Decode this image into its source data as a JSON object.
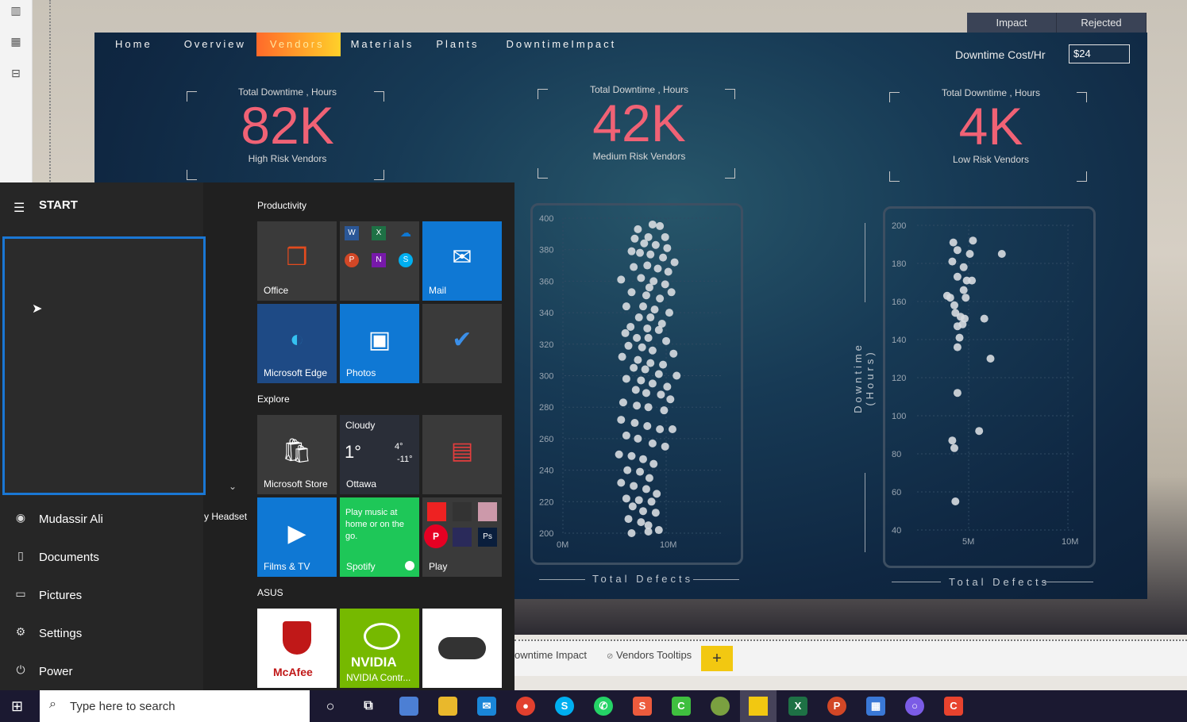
{
  "report": {
    "nav": [
      "Home",
      "Overview",
      "Vendors",
      "Materials",
      "Plants",
      "DowntimeImpact"
    ],
    "active_nav": "Vendors",
    "top_tabs": [
      "Impact",
      "Rejected"
    ],
    "cost_label": "Downtime Cost/Hr",
    "cost_value": "$24",
    "kpis": [
      {
        "caption": "Total Downtime , Hours",
        "value": "82K",
        "sub": "High Risk Vendors"
      },
      {
        "caption": "Total Downtime , Hours",
        "value": "42K",
        "sub": "Medium Risk Vendors"
      },
      {
        "caption": "Total Downtime , Hours",
        "value": "4K",
        "sub": "Low Risk Vendors"
      }
    ],
    "y_axis_title": "Downtime (Hours)",
    "accent": "#f06275"
  },
  "chart_data": [
    {
      "type": "scatter",
      "xlabel": "Total Defects",
      "x_ticks": [
        "0M",
        "10M"
      ],
      "y_ticks": [
        "400",
        "380",
        "360",
        "340",
        "320",
        "300",
        "280",
        "260",
        "240",
        "220",
        "200"
      ],
      "ylim": [
        200,
        400
      ],
      "points": [
        [
          7.0,
          393
        ],
        [
          8.4,
          396
        ],
        [
          9.1,
          395
        ],
        [
          8.0,
          388
        ],
        [
          9.6,
          388
        ],
        [
          6.7,
          387
        ],
        [
          7.6,
          384
        ],
        [
          8.7,
          383
        ],
        [
          9.8,
          381
        ],
        [
          6.4,
          379
        ],
        [
          7.2,
          378
        ],
        [
          8.2,
          377
        ],
        [
          9.4,
          375
        ],
        [
          10.5,
          372
        ],
        [
          7.9,
          370
        ],
        [
          8.9,
          368
        ],
        [
          6.6,
          369
        ],
        [
          9.9,
          366
        ],
        [
          5.4,
          361
        ],
        [
          7.3,
          362
        ],
        [
          8.5,
          360
        ],
        [
          9.6,
          358
        ],
        [
          8.1,
          356
        ],
        [
          10.2,
          353
        ],
        [
          6.4,
          353
        ],
        [
          7.8,
          351
        ],
        [
          9.1,
          349
        ],
        [
          5.9,
          344
        ],
        [
          7.5,
          344
        ],
        [
          8.6,
          342
        ],
        [
          10.0,
          340
        ],
        [
          7.1,
          337
        ],
        [
          8.2,
          337
        ],
        [
          9.3,
          333
        ],
        [
          6.3,
          331
        ],
        [
          7.9,
          330
        ],
        [
          9.0,
          329
        ],
        [
          5.8,
          327
        ],
        [
          6.9,
          324
        ],
        [
          8.0,
          324
        ],
        [
          9.7,
          322
        ],
        [
          6.1,
          319
        ],
        [
          7.4,
          318
        ],
        [
          8.4,
          316
        ],
        [
          10.4,
          314
        ],
        [
          5.5,
          312
        ],
        [
          7.0,
          310
        ],
        [
          8.2,
          308
        ],
        [
          9.4,
          307
        ],
        [
          6.6,
          305
        ],
        [
          7.7,
          304
        ],
        [
          9.0,
          301
        ],
        [
          10.7,
          300
        ],
        [
          5.9,
          298
        ],
        [
          7.3,
          297
        ],
        [
          8.4,
          295
        ],
        [
          9.8,
          293
        ],
        [
          6.8,
          291
        ],
        [
          7.8,
          289
        ],
        [
          9.2,
          288
        ],
        [
          10.1,
          285
        ],
        [
          5.6,
          283
        ],
        [
          6.9,
          281
        ],
        [
          8.0,
          280
        ],
        [
          9.5,
          278
        ],
        [
          5.4,
          272
        ],
        [
          6.7,
          270
        ],
        [
          7.9,
          268
        ],
        [
          9.1,
          266
        ],
        [
          10.3,
          266
        ],
        [
          5.9,
          262
        ],
        [
          7.0,
          260
        ],
        [
          8.4,
          257
        ],
        [
          9.6,
          255
        ],
        [
          5.2,
          250
        ],
        [
          6.4,
          249
        ],
        [
          7.5,
          247
        ],
        [
          8.5,
          244
        ],
        [
          6.0,
          240
        ],
        [
          7.2,
          239
        ],
        [
          8.1,
          235
        ],
        [
          5.4,
          232
        ],
        [
          6.6,
          230
        ],
        [
          7.8,
          228
        ],
        [
          8.8,
          225
        ],
        [
          5.9,
          222
        ],
        [
          7.1,
          221
        ],
        [
          8.3,
          220
        ],
        [
          6.5,
          217
        ],
        [
          7.5,
          214
        ],
        [
          8.7,
          213
        ],
        [
          6.1,
          209
        ],
        [
          7.3,
          207
        ],
        [
          8.0,
          205
        ],
        [
          9.0,
          202
        ],
        [
          6.4,
          200
        ],
        [
          8.0,
          201
        ]
      ]
    },
    {
      "type": "scatter",
      "xlabel": "Total Defects",
      "x_ticks": [
        "5M",
        "10M"
      ],
      "y_ticks": [
        "200",
        "180",
        "160",
        "140",
        "120",
        "100",
        "80",
        "60",
        "40"
      ],
      "ylim": [
        40,
        200
      ],
      "points": [
        [
          4.9,
          191
        ],
        [
          6.8,
          192
        ],
        [
          5.3,
          187
        ],
        [
          6.5,
          185
        ],
        [
          9.6,
          185
        ],
        [
          4.8,
          181
        ],
        [
          5.9,
          178
        ],
        [
          5.3,
          173
        ],
        [
          6.2,
          171
        ],
        [
          6.7,
          171
        ],
        [
          5.9,
          166
        ],
        [
          6.1,
          162
        ],
        [
          4.3,
          163
        ],
        [
          4.6,
          162
        ],
        [
          5.0,
          158
        ],
        [
          5.1,
          154
        ],
        [
          5.6,
          152
        ],
        [
          6.0,
          151
        ],
        [
          5.8,
          148
        ],
        [
          7.9,
          151
        ],
        [
          5.3,
          147
        ],
        [
          5.5,
          141
        ],
        [
          5.3,
          136
        ],
        [
          8.5,
          130
        ],
        [
          5.3,
          112
        ],
        [
          7.4,
          92
        ],
        [
          4.8,
          87
        ],
        [
          5.0,
          83
        ],
        [
          5.1,
          55
        ]
      ]
    }
  ],
  "start_menu": {
    "title": "START",
    "side": [
      {
        "icon": "user-icon",
        "label": "Mudassir Ali"
      },
      {
        "icon": "document-icon",
        "label": "Documents"
      },
      {
        "icon": "pictures-icon",
        "label": "Pictures"
      },
      {
        "icon": "gear-icon",
        "label": "Settings"
      },
      {
        "icon": "power-icon",
        "label": "Power"
      }
    ],
    "partial_label": "y Headset",
    "groups": [
      "Productivity",
      "Explore",
      "ASUS"
    ],
    "tiles": [
      {
        "label": "Office",
        "color": "#3a3a3a"
      },
      {
        "label": "",
        "color": "#3a3a3a"
      },
      {
        "label": "Mail",
        "color": "#0f78d4"
      },
      {
        "label": "Microsoft Edge",
        "color": "#1e4a85"
      },
      {
        "label": "Photos",
        "color": "#0f78d4"
      },
      {
        "label": "",
        "color": "#3a3a3a"
      },
      {
        "label": "Microsoft Store",
        "color": "#3a3a3a"
      },
      {
        "label": "Ottawa",
        "color": "#2a2e38"
      },
      {
        "label": "",
        "color": "#3a3a3a"
      },
      {
        "label": "Films & TV",
        "color": "#0f78d4"
      },
      {
        "label": "Spotify",
        "color": "#1ec758"
      },
      {
        "label": "Play",
        "color": "#3a3a3a"
      },
      {
        "label": "",
        "color": "#ffffff"
      },
      {
        "label": "NVIDIA Contr...",
        "color": "#76b900"
      },
      {
        "label": "",
        "color": "#ffffff"
      }
    ],
    "weather": {
      "cond": "Cloudy",
      "temp": "1°",
      "hi": "4°",
      "lo": "-11°"
    },
    "spotify_text": "Play music at home or on the go.",
    "mcafee": "McAfee",
    "nvidia": "NVIDIA"
  },
  "page_tabs": [
    "owntime Impact",
    "Vendors Tooltips"
  ],
  "taskbar": {
    "search_placeholder": "Type here to search"
  }
}
